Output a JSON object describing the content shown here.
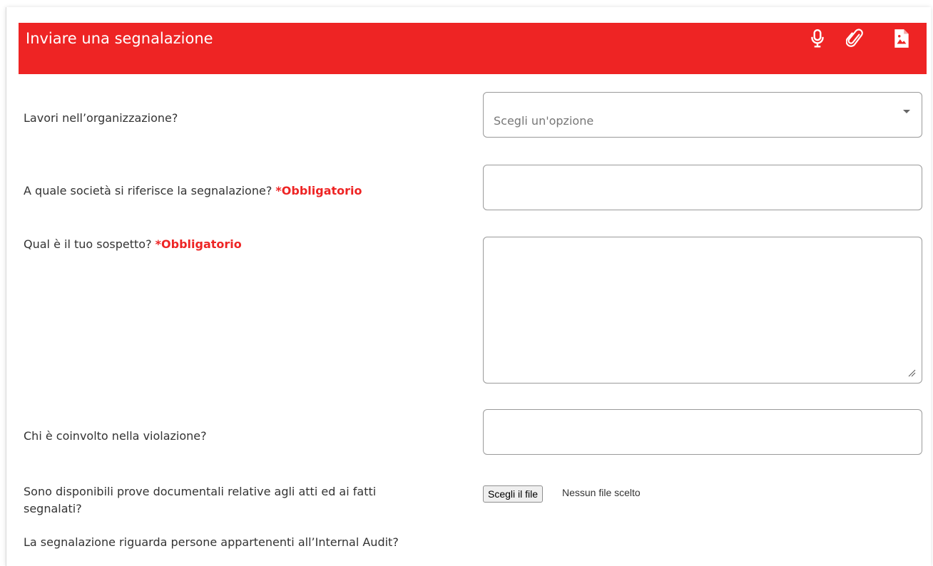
{
  "header": {
    "title": "Inviare una segnalazione",
    "icons": [
      "microphone-icon",
      "paperclip-icon",
      "image-file-icon"
    ]
  },
  "form": {
    "required_label": "*Obbligatorio",
    "q1": {
      "label": "Lavori nell’organizzazione?",
      "placeholder": "Scegli un'opzione"
    },
    "q2": {
      "label": "A quale società si riferisce la segnalazione?",
      "value": ""
    },
    "q3": {
      "label": "Qual è il tuo sospetto?",
      "value": ""
    },
    "q4": {
      "label": "Chi è coinvolto nella violazione?",
      "value": ""
    },
    "q5": {
      "label_line1": "Sono disponibili prove documentali relative agli atti ed ai fatti",
      "label_line2": "segnalati?",
      "button": "Scegli il file",
      "status": "Nessun file scelto"
    },
    "q6": {
      "label": "La segnalazione riguarda persone appartenenti all’Internal Audit?"
    }
  },
  "colors": {
    "accent": "#ee2424",
    "text": "#333333",
    "border": "#9a9a9a"
  }
}
